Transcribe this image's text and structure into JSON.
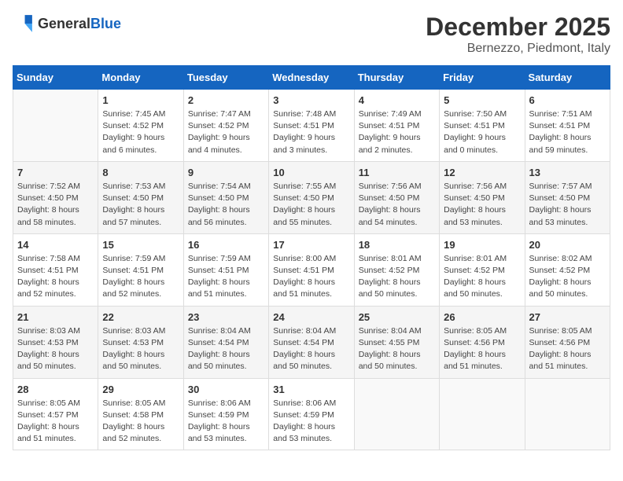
{
  "header": {
    "logo_general": "General",
    "logo_blue": "Blue",
    "month": "December 2025",
    "location": "Bernezzo, Piedmont, Italy"
  },
  "weekdays": [
    "Sunday",
    "Monday",
    "Tuesday",
    "Wednesday",
    "Thursday",
    "Friday",
    "Saturday"
  ],
  "weeks": [
    [
      {
        "day": "",
        "info": ""
      },
      {
        "day": "1",
        "info": "Sunrise: 7:45 AM\nSunset: 4:52 PM\nDaylight: 9 hours\nand 6 minutes."
      },
      {
        "day": "2",
        "info": "Sunrise: 7:47 AM\nSunset: 4:52 PM\nDaylight: 9 hours\nand 4 minutes."
      },
      {
        "day": "3",
        "info": "Sunrise: 7:48 AM\nSunset: 4:51 PM\nDaylight: 9 hours\nand 3 minutes."
      },
      {
        "day": "4",
        "info": "Sunrise: 7:49 AM\nSunset: 4:51 PM\nDaylight: 9 hours\nand 2 minutes."
      },
      {
        "day": "5",
        "info": "Sunrise: 7:50 AM\nSunset: 4:51 PM\nDaylight: 9 hours\nand 0 minutes."
      },
      {
        "day": "6",
        "info": "Sunrise: 7:51 AM\nSunset: 4:51 PM\nDaylight: 8 hours\nand 59 minutes."
      }
    ],
    [
      {
        "day": "7",
        "info": "Sunrise: 7:52 AM\nSunset: 4:50 PM\nDaylight: 8 hours\nand 58 minutes."
      },
      {
        "day": "8",
        "info": "Sunrise: 7:53 AM\nSunset: 4:50 PM\nDaylight: 8 hours\nand 57 minutes."
      },
      {
        "day": "9",
        "info": "Sunrise: 7:54 AM\nSunset: 4:50 PM\nDaylight: 8 hours\nand 56 minutes."
      },
      {
        "day": "10",
        "info": "Sunrise: 7:55 AM\nSunset: 4:50 PM\nDaylight: 8 hours\nand 55 minutes."
      },
      {
        "day": "11",
        "info": "Sunrise: 7:56 AM\nSunset: 4:50 PM\nDaylight: 8 hours\nand 54 minutes."
      },
      {
        "day": "12",
        "info": "Sunrise: 7:56 AM\nSunset: 4:50 PM\nDaylight: 8 hours\nand 53 minutes."
      },
      {
        "day": "13",
        "info": "Sunrise: 7:57 AM\nSunset: 4:50 PM\nDaylight: 8 hours\nand 53 minutes."
      }
    ],
    [
      {
        "day": "14",
        "info": "Sunrise: 7:58 AM\nSunset: 4:51 PM\nDaylight: 8 hours\nand 52 minutes."
      },
      {
        "day": "15",
        "info": "Sunrise: 7:59 AM\nSunset: 4:51 PM\nDaylight: 8 hours\nand 52 minutes."
      },
      {
        "day": "16",
        "info": "Sunrise: 7:59 AM\nSunset: 4:51 PM\nDaylight: 8 hours\nand 51 minutes."
      },
      {
        "day": "17",
        "info": "Sunrise: 8:00 AM\nSunset: 4:51 PM\nDaylight: 8 hours\nand 51 minutes."
      },
      {
        "day": "18",
        "info": "Sunrise: 8:01 AM\nSunset: 4:52 PM\nDaylight: 8 hours\nand 50 minutes."
      },
      {
        "day": "19",
        "info": "Sunrise: 8:01 AM\nSunset: 4:52 PM\nDaylight: 8 hours\nand 50 minutes."
      },
      {
        "day": "20",
        "info": "Sunrise: 8:02 AM\nSunset: 4:52 PM\nDaylight: 8 hours\nand 50 minutes."
      }
    ],
    [
      {
        "day": "21",
        "info": "Sunrise: 8:03 AM\nSunset: 4:53 PM\nDaylight: 8 hours\nand 50 minutes."
      },
      {
        "day": "22",
        "info": "Sunrise: 8:03 AM\nSunset: 4:53 PM\nDaylight: 8 hours\nand 50 minutes."
      },
      {
        "day": "23",
        "info": "Sunrise: 8:04 AM\nSunset: 4:54 PM\nDaylight: 8 hours\nand 50 minutes."
      },
      {
        "day": "24",
        "info": "Sunrise: 8:04 AM\nSunset: 4:54 PM\nDaylight: 8 hours\nand 50 minutes."
      },
      {
        "day": "25",
        "info": "Sunrise: 8:04 AM\nSunset: 4:55 PM\nDaylight: 8 hours\nand 50 minutes."
      },
      {
        "day": "26",
        "info": "Sunrise: 8:05 AM\nSunset: 4:56 PM\nDaylight: 8 hours\nand 51 minutes."
      },
      {
        "day": "27",
        "info": "Sunrise: 8:05 AM\nSunset: 4:56 PM\nDaylight: 8 hours\nand 51 minutes."
      }
    ],
    [
      {
        "day": "28",
        "info": "Sunrise: 8:05 AM\nSunset: 4:57 PM\nDaylight: 8 hours\nand 51 minutes."
      },
      {
        "day": "29",
        "info": "Sunrise: 8:05 AM\nSunset: 4:58 PM\nDaylight: 8 hours\nand 52 minutes."
      },
      {
        "day": "30",
        "info": "Sunrise: 8:06 AM\nSunset: 4:59 PM\nDaylight: 8 hours\nand 53 minutes."
      },
      {
        "day": "31",
        "info": "Sunrise: 8:06 AM\nSunset: 4:59 PM\nDaylight: 8 hours\nand 53 minutes."
      },
      {
        "day": "",
        "info": ""
      },
      {
        "day": "",
        "info": ""
      },
      {
        "day": "",
        "info": ""
      }
    ]
  ]
}
